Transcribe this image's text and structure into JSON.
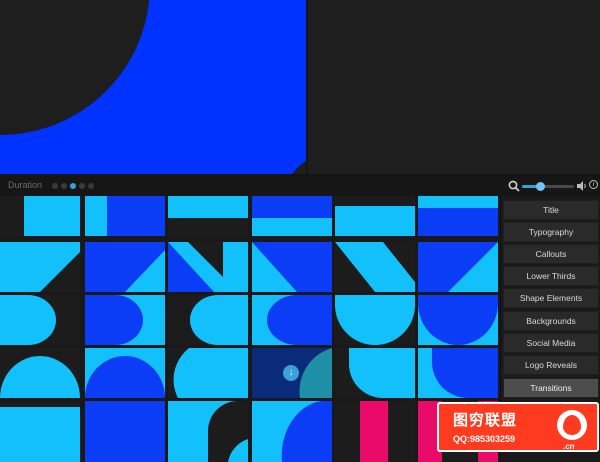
{
  "toolbar": {
    "duration_label": "Duration",
    "duration_dots": 5,
    "duration_selected_index": 2,
    "zoom_level": 0.35,
    "search_icon": "search-icon",
    "volume_icon": "volume-icon",
    "info_icon": "info-icon",
    "info_glyph": "i"
  },
  "sidebar": {
    "items": [
      {
        "label": "Title"
      },
      {
        "label": "Typography"
      },
      {
        "label": "Callouts"
      },
      {
        "label": "Lower Thirds"
      },
      {
        "label": "Shape Elements"
      },
      {
        "label": "Backgrounds"
      },
      {
        "label": "Social Media"
      },
      {
        "label": "Logo Reveals"
      },
      {
        "label": "Transitions"
      }
    ],
    "selected": "Transitions"
  },
  "grid": {
    "download_icon": "download-icon",
    "download_glyph": "↓"
  },
  "watermark": {
    "title": "图穷联盟",
    "qq": "QQ:985303259",
    "badge_suffix": ".cn"
  },
  "colors": {
    "cyan": "#12c1fb",
    "blue": "#0a3df5",
    "magenta": "#ea0a6a",
    "accent": "#3aa0d8",
    "dark": "#1c1c1c"
  }
}
